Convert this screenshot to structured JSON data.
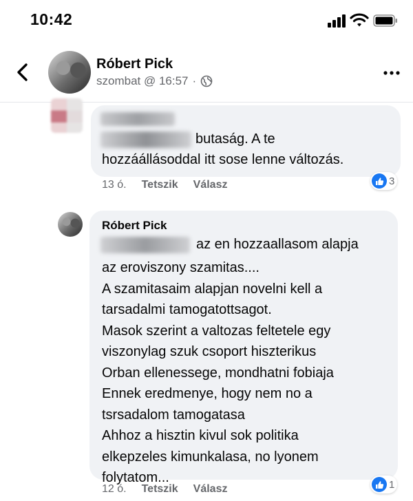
{
  "status_bar": {
    "time": "10:42"
  },
  "header": {
    "name": "Róbert Pick",
    "timestamp": "szombat @ 16:57",
    "separator": "·"
  },
  "comment": {
    "text_after_tag": "butaság. A te",
    "line2": "hozzáállásoddal itt sose lenne változás.",
    "time": "13 ó.",
    "like_label": "Tetszik",
    "reply_label": "Válasz",
    "reaction_count": "3"
  },
  "reply": {
    "author": "Róbert Pick",
    "first_line_after_tag": "az en hozzaallasom alapja",
    "lines": [
      "az eroviszony szamitas....",
      "A szamitasaim alapjan novelni kell a",
      "tarsadalmi tamogatottsagot.",
      "Masok szerint a valtozas feltetele egy",
      "viszonylag szuk csoport hiszterikus",
      "Orban ellenessege, mondhatni fobiaja",
      "Ennek eredmenye, hogy nem no a",
      "tsrsadalom tamogatasa",
      "Ahhoz a hisztin kivul sok politika",
      "elkepzeles kimunkalasa, no lyonem",
      "folytatom..."
    ],
    "time": "12 ó.",
    "like_label": "Tetszik",
    "reply_label": "Válasz",
    "reaction_count": "1"
  },
  "icons": {
    "back": "chevron-left-icon",
    "privacy": "globe-icon",
    "more": "more-horizontal-icon",
    "reaction": "like-icon"
  },
  "colors": {
    "like_blue": "#1877f2",
    "bubble_bg": "#f0f2f5",
    "meta_gray": "#65676b"
  }
}
